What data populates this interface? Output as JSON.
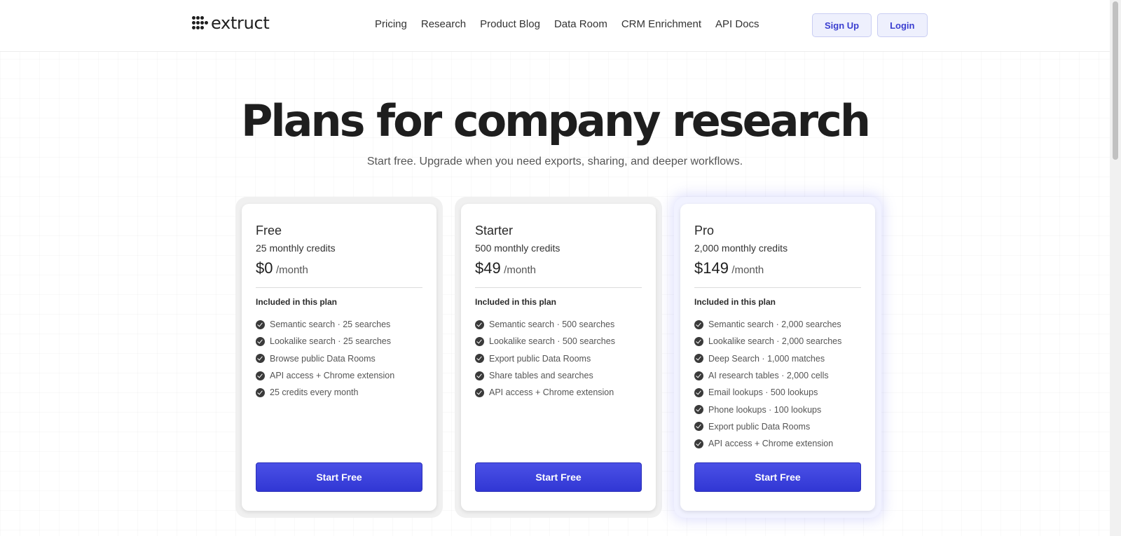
{
  "header": {
    "logo_text": "extruct",
    "nav": [
      "Pricing",
      "Research",
      "Product Blog",
      "Data Room",
      "CRM Enrichment",
      "API Docs"
    ],
    "signup_label": "Sign Up",
    "login_label": "Login"
  },
  "hero": {
    "title": "Plans for company research",
    "subtitle": "Start free. Upgrade when you need exports, sharing, and deeper workflows."
  },
  "plans": [
    {
      "name": "Free",
      "credits": "25 monthly credits",
      "price": "$0",
      "period": "/month",
      "included_label": "Included in this plan",
      "features": [
        "Semantic search · 25 searches",
        "Lookalike search · 25 searches",
        "Browse public Data Rooms",
        "API access + Chrome extension",
        "25 credits every month"
      ],
      "cta": "Start Free"
    },
    {
      "name": "Starter",
      "credits": "500 monthly credits",
      "price": "$49",
      "period": "/month",
      "included_label": "Included in this plan",
      "features": [
        "Semantic search · 500 searches",
        "Lookalike search · 500 searches",
        "Export public Data Rooms",
        "Share tables and searches",
        "API access + Chrome extension"
      ],
      "cta": "Start Free"
    },
    {
      "name": "Pro",
      "credits": "2,000 monthly credits",
      "price": "$149",
      "period": "/month",
      "included_label": "Included in this plan",
      "features": [
        "Semantic search · 2,000 searches",
        "Lookalike search · 2,000 searches",
        "Deep Search · 1,000 matches",
        "AI research tables · 2,000 cells",
        "Email lookups · 500 lookups",
        "Phone lookups · 100 lookups",
        "Export public Data Rooms",
        "API access + Chrome extension"
      ],
      "cta": "Start Free"
    }
  ],
  "colors": {
    "accent": "#3a40d8",
    "auth_bg": "#eef0fd",
    "pro_glow": "#7078f0"
  }
}
